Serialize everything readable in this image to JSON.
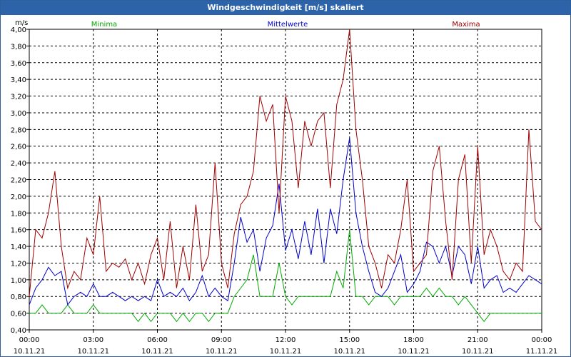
{
  "chart_data": {
    "type": "line",
    "title": "Windgeschwindigkeit [m/s] skaliert",
    "ylabel": "m/s",
    "ylim": [
      0.4,
      4.0
    ],
    "xlim": [
      "00:00",
      "24:00"
    ],
    "y_ticks": [
      "0,40",
      "0,60",
      "0,80",
      "1,00",
      "1,20",
      "1,40",
      "1,60",
      "1,80",
      "2,00",
      "2,20",
      "2,40",
      "2,60",
      "2,80",
      "3,00",
      "3,20",
      "3,40",
      "3,60",
      "3,80",
      "4,00"
    ],
    "x_ticks": [
      {
        "time": "00:00",
        "date": "10.11.21"
      },
      {
        "time": "03:00",
        "date": "10.11.21"
      },
      {
        "time": "06:00",
        "date": "10.11.21"
      },
      {
        "time": "09:00",
        "date": "10.11.21"
      },
      {
        "time": "12:00",
        "date": "10.11.21"
      },
      {
        "time": "15:00",
        "date": "10.11.21"
      },
      {
        "time": "18:00",
        "date": "10.11.21"
      },
      {
        "time": "21:00",
        "date": "10.11.21"
      },
      {
        "time": "00:00",
        "date": "11.11.21"
      }
    ],
    "grid": true,
    "legend_placement": "top",
    "series": [
      {
        "name": "Minima",
        "color": "#00aa00",
        "x": [
          0,
          0.3,
          0.6,
          0.9,
          1.2,
          1.5,
          1.8,
          2.1,
          2.4,
          2.7,
          3,
          3.3,
          3.6,
          3.9,
          4.2,
          4.5,
          4.8,
          5.1,
          5.4,
          5.7,
          6,
          6.3,
          6.6,
          6.9,
          7.2,
          7.5,
          7.8,
          8.1,
          8.4,
          8.7,
          9,
          9.3,
          9.6,
          9.9,
          10.2,
          10.5,
          10.8,
          11.1,
          11.4,
          11.7,
          12,
          12.3,
          12.6,
          12.9,
          13.2,
          13.5,
          13.8,
          14.1,
          14.4,
          14.7,
          15,
          15.3,
          15.6,
          15.9,
          16.2,
          16.5,
          16.8,
          17.1,
          17.4,
          17.7,
          18,
          18.3,
          18.6,
          18.9,
          19.2,
          19.5,
          19.8,
          20.1,
          20.4,
          20.7,
          21,
          21.3,
          21.6,
          21.9,
          22.2,
          22.5,
          22.8,
          23.1,
          23.4,
          23.7,
          24
        ],
        "values": [
          0.6,
          0.6,
          0.7,
          0.6,
          0.6,
          0.6,
          0.7,
          0.6,
          0.6,
          0.6,
          0.7,
          0.6,
          0.6,
          0.6,
          0.6,
          0.6,
          0.6,
          0.5,
          0.6,
          0.5,
          0.6,
          0.6,
          0.6,
          0.5,
          0.6,
          0.5,
          0.6,
          0.6,
          0.5,
          0.6,
          0.6,
          0.6,
          0.8,
          0.9,
          1.0,
          1.3,
          0.8,
          0.8,
          0.8,
          1.2,
          0.8,
          0.7,
          0.8,
          0.8,
          0.8,
          0.8,
          0.8,
          0.8,
          1.1,
          0.9,
          1.6,
          0.8,
          0.8,
          0.7,
          0.8,
          0.8,
          0.8,
          0.7,
          0.8,
          0.8,
          0.8,
          0.8,
          0.9,
          0.8,
          0.9,
          0.8,
          0.8,
          0.7,
          0.8,
          0.7,
          0.6,
          0.5,
          0.6,
          0.6,
          0.6,
          0.6,
          0.6,
          0.6,
          0.6,
          0.6,
          0.6
        ]
      },
      {
        "name": "Mittelwerte",
        "color": "#0000cc",
        "x": [
          0,
          0.3,
          0.6,
          0.9,
          1.2,
          1.5,
          1.8,
          2.1,
          2.4,
          2.7,
          3,
          3.3,
          3.6,
          3.9,
          4.2,
          4.5,
          4.8,
          5.1,
          5.4,
          5.7,
          6,
          6.3,
          6.6,
          6.9,
          7.2,
          7.5,
          7.8,
          8.1,
          8.4,
          8.7,
          9,
          9.3,
          9.6,
          9.9,
          10.2,
          10.5,
          10.8,
          11.1,
          11.4,
          11.7,
          12,
          12.3,
          12.6,
          12.9,
          13.2,
          13.5,
          13.8,
          14.1,
          14.4,
          14.7,
          15,
          15.3,
          15.6,
          15.9,
          16.2,
          16.5,
          16.8,
          17.1,
          17.4,
          17.7,
          18,
          18.3,
          18.6,
          18.9,
          19.2,
          19.5,
          19.8,
          20.1,
          20.4,
          20.7,
          21,
          21.3,
          21.6,
          21.9,
          22.2,
          22.5,
          22.8,
          23.1,
          23.4,
          23.7,
          24
        ],
        "values": [
          0.7,
          0.9,
          1.0,
          1.15,
          1.05,
          1.1,
          0.7,
          0.8,
          0.85,
          0.8,
          0.95,
          0.8,
          0.8,
          0.85,
          0.8,
          0.75,
          0.8,
          0.75,
          0.8,
          0.75,
          1.0,
          0.8,
          0.85,
          0.8,
          0.9,
          0.75,
          0.85,
          1.05,
          0.8,
          0.9,
          0.8,
          0.75,
          1.2,
          1.75,
          1.45,
          1.6,
          1.1,
          1.5,
          1.65,
          2.15,
          1.35,
          1.6,
          1.25,
          1.7,
          1.3,
          1.85,
          1.2,
          1.85,
          1.55,
          2.2,
          2.7,
          1.8,
          1.4,
          1.1,
          0.85,
          0.8,
          0.9,
          1.1,
          1.3,
          0.85,
          0.95,
          1.1,
          1.45,
          1.4,
          1.2,
          1.4,
          1.05,
          1.4,
          1.3,
          0.95,
          1.4,
          0.9,
          1.0,
          1.05,
          0.85,
          0.9,
          0.85,
          0.95,
          1.05,
          1.0,
          0.95
        ]
      },
      {
        "name": "Maxima",
        "color": "#a00000",
        "x": [
          0,
          0.3,
          0.6,
          0.9,
          1.2,
          1.5,
          1.8,
          2.1,
          2.4,
          2.7,
          3,
          3.3,
          3.6,
          3.9,
          4.2,
          4.5,
          4.8,
          5.1,
          5.4,
          5.7,
          6,
          6.3,
          6.6,
          6.9,
          7.2,
          7.5,
          7.8,
          8.1,
          8.4,
          8.7,
          9,
          9.3,
          9.6,
          9.9,
          10.2,
          10.5,
          10.8,
          11.1,
          11.4,
          11.7,
          12,
          12.3,
          12.6,
          12.9,
          13.2,
          13.5,
          13.8,
          14.1,
          14.4,
          14.7,
          15,
          15.3,
          15.6,
          15.9,
          16.2,
          16.5,
          16.8,
          17.1,
          17.4,
          17.7,
          18,
          18.3,
          18.6,
          18.9,
          19.2,
          19.5,
          19.8,
          20.1,
          20.4,
          20.7,
          21,
          21.3,
          21.6,
          21.9,
          22.2,
          22.5,
          22.8,
          23.1,
          23.4,
          23.7,
          24
        ],
        "values": [
          0.8,
          1.6,
          1.5,
          1.8,
          2.3,
          1.4,
          0.9,
          1.1,
          1.0,
          1.5,
          1.3,
          2.0,
          1.1,
          1.2,
          1.15,
          1.25,
          1.0,
          1.2,
          0.95,
          1.3,
          1.5,
          1.0,
          1.7,
          0.9,
          1.4,
          1.0,
          1.9,
          1.1,
          1.3,
          2.4,
          1.2,
          0.9,
          1.55,
          1.9,
          2.0,
          2.3,
          3.2,
          2.9,
          3.1,
          1.8,
          3.2,
          2.9,
          2.1,
          2.9,
          2.6,
          2.9,
          3.0,
          2.1,
          3.1,
          3.4,
          4.0,
          2.8,
          2.2,
          1.4,
          1.2,
          0.9,
          1.3,
          1.2,
          1.6,
          2.2,
          1.1,
          1.2,
          1.3,
          2.3,
          2.6,
          1.7,
          1.0,
          2.2,
          2.5,
          1.2,
          2.6,
          1.3,
          1.6,
          1.4,
          1.1,
          1.0,
          1.2,
          1.1,
          2.8,
          1.7,
          1.6
        ]
      }
    ]
  }
}
